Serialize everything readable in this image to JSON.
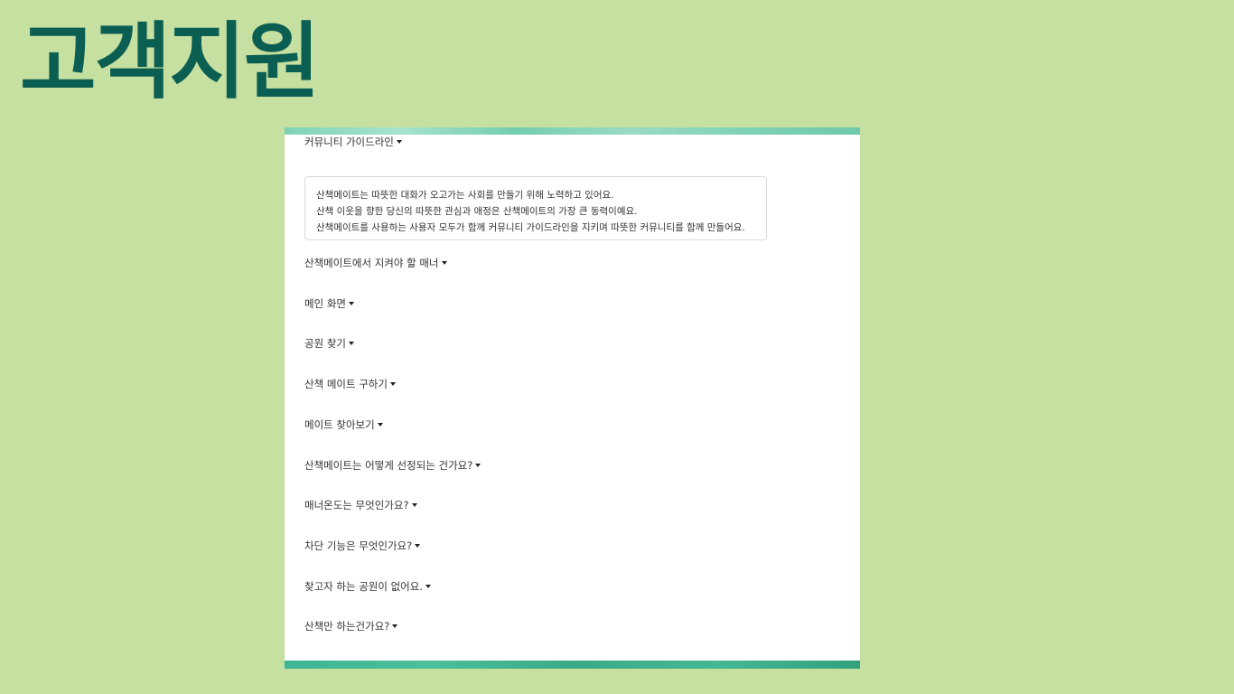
{
  "page": {
    "title": "고객지원"
  },
  "faq": {
    "items": [
      {
        "label": "커뮤니티 가이드라인"
      },
      {
        "label": "산책메이트에서 지켜야 할 매너"
      },
      {
        "label": "메인 화면"
      },
      {
        "label": "공원 찾기"
      },
      {
        "label": "산책 메이트 구하기"
      },
      {
        "label": "메이트 찾아보기"
      },
      {
        "label": "산책메이트는 어떻게 선정되는 건가요?"
      },
      {
        "label": "매너온도는 무엇인가요?"
      },
      {
        "label": "차단 기능은 무엇인가요?"
      },
      {
        "label": "찾고자 하는 공원이 없어요."
      },
      {
        "label": "산책만 하는건가요?"
      }
    ],
    "expanded_answer": {
      "lines": [
        "산책메이트는 따뜻한 대화가 오고가는 사회를 만들기 위해 노력하고 있어요.",
        "산책 이웃을 향한 당신의 따뜻한 관심과 애정은 산책메이트의 가장 큰 동력이예요.",
        "산책메이트를 사용하는 사용자 모두가 함께 커뮤니티 가이드라인을 지키며 따뜻한 커뮤니티를 함께 만들어요."
      ]
    }
  },
  "colors": {
    "background": "#c5e0a0",
    "title": "#0b5e52",
    "card": "#ffffff",
    "stripe_top": "#7fd2b6",
    "stripe_bottom": "#3db592"
  },
  "icons": {
    "toggle": "caret-down-icon"
  }
}
